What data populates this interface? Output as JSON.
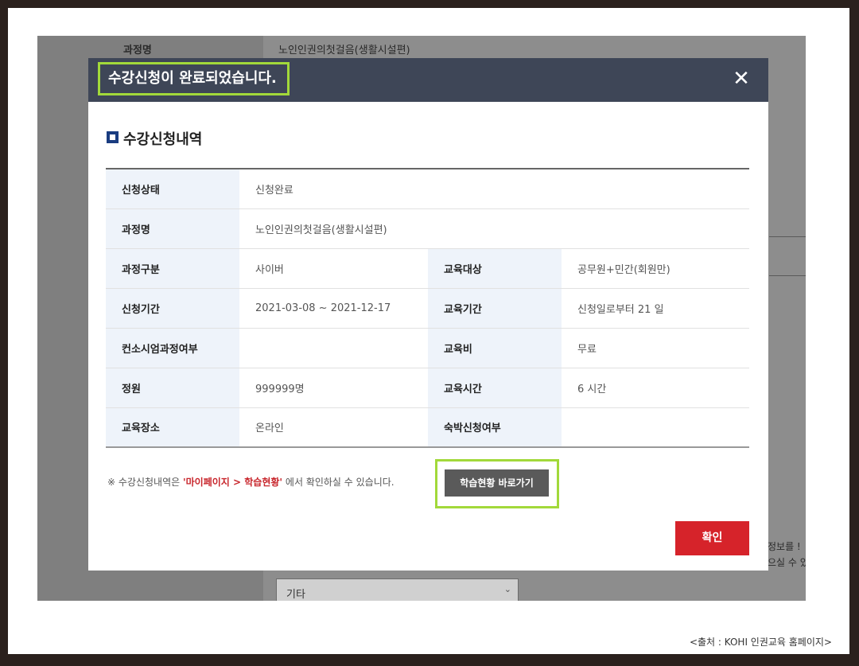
{
  "background_page": {
    "row_label": "과정명",
    "row_value": "노인인권의첫걸음(생활시설편)",
    "select_value": "기타",
    "side_text_1": "정보를 !",
    "side_text_2": "으실 수 있"
  },
  "modal": {
    "title": "수강신청이 완료되었습니다.",
    "close_icon": "close-icon",
    "section_title": "수강신청내역",
    "rows": [
      {
        "label1": "신청상태",
        "value1": "신청완료"
      },
      {
        "label1": "과정명",
        "value1": "노인인권의첫걸음(생활시설편)"
      },
      {
        "label1": "과정구분",
        "value1": "사이버",
        "label2": "교육대상",
        "value2": "공무원+민간(회원만)"
      },
      {
        "label1": "신청기간",
        "value1": "2021-03-08 ~ 2021-12-17",
        "label2": "교육기간",
        "value2": "신청일로부터 21 일"
      },
      {
        "label1": "컨소시엄과정여부",
        "value1": "",
        "label2": "교육비",
        "value2": "무료"
      },
      {
        "label1": "정원",
        "value1": "999999명",
        "label2": "교육시간",
        "value2": "6 시간"
      },
      {
        "label1": "교육장소",
        "value1": "온라인",
        "label2": "숙박신청여부",
        "value2": ""
      }
    ],
    "note_prefix": "※ 수강신청내역은 ",
    "note_link": "'마이페이지 > 학습현황'",
    "note_suffix": " 에서 확인하실 수 있습니다.",
    "go_button": "학습현황 바로가기",
    "confirm_button": "확인"
  },
  "source_caption": "<출처 : KOHI 인권교육 홈페이지>",
  "colors": {
    "header_bg": "#3e4657",
    "highlight": "#a2d93a",
    "confirm": "#d6232a",
    "label_bg": "#eef3fa"
  }
}
